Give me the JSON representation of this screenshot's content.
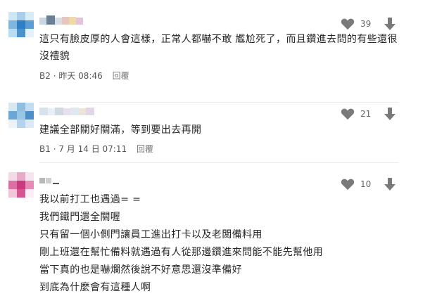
{
  "comments": [
    {
      "id": "B2",
      "lines": [
        "這只有臉皮厚的人會這樣，正常人都嚇不敢 尷尬死了，而且鑽進去問的有些還很",
        "沒禮貌"
      ],
      "floor": "B2",
      "time": "昨天 08:46",
      "reply_label": "回覆",
      "likes": "39"
    },
    {
      "id": "B1",
      "lines": [
        "建議全部關好關滿，等到要出去再開"
      ],
      "floor": "B1",
      "time": "7 月 14 日 07:11",
      "reply_label": "回覆",
      "likes": "21"
    },
    {
      "id": "B0",
      "lines": [
        "我以前打工也遇過= =",
        "我們鐵門還全關喔",
        "只有留一個小側門讓員工進出打卡以及老闆備料用",
        "剛上班還在幫忙備料就遇過有人從那邊鑽進來問能不能先幫他用",
        "當下真的也是嚇爛然後說不好意思還沒準備好",
        "到底為什麼會有這種人啊"
      ],
      "likes": "10"
    }
  ],
  "separator": "·",
  "icons": {
    "like": "heart-icon",
    "downvote": "arrow-down-icon"
  },
  "colors": {
    "icon_gray": "#7a7a7a",
    "text": "#262626",
    "meta": "#555555"
  }
}
